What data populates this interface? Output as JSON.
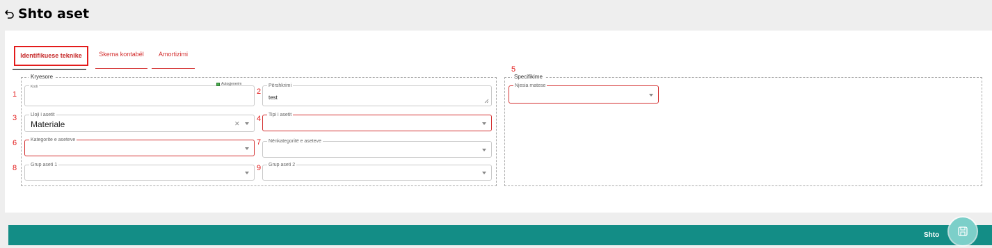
{
  "header": {
    "title": "Shto aset",
    "back_icon": "undo-arrow-icon"
  },
  "tabs": [
    {
      "label": "Identifikuese teknike",
      "active": true
    },
    {
      "label": "Skema kontabël",
      "active": false
    },
    {
      "label": "Amortizimi",
      "active": false
    }
  ],
  "kryesore": {
    "legend": "Kryesore",
    "kodi": {
      "label": "Kodi",
      "value": ""
    },
    "autogjenerim": {
      "label": "Autogjenerim",
      "checked": true
    },
    "pershkrimi": {
      "label": "Përshkrimi",
      "value": "test"
    },
    "lloji": {
      "label": "Lloji i asetit",
      "value": "Materiale"
    },
    "tipi": {
      "label": "Tipi i asetit",
      "value": ""
    },
    "kategorite": {
      "label": "Kategorite e aseteve",
      "value": ""
    },
    "nenkategorite": {
      "label": "Nënkategoritë e aseteve",
      "value": ""
    },
    "grup1": {
      "label": "Grup aseti 1",
      "value": ""
    },
    "grup2": {
      "label": "Grup aseti 2",
      "value": ""
    }
  },
  "specifikime": {
    "legend": "Specifikime",
    "njesia": {
      "label": "Njesia matese",
      "value": ""
    }
  },
  "annotations": [
    "1",
    "2",
    "3",
    "4",
    "5",
    "6",
    "7",
    "8",
    "9"
  ],
  "footer": {
    "submit_label": "Shto",
    "save_icon": "save-floppy-icon"
  },
  "colors": {
    "accent": "#138d86",
    "error": "#e31b1b",
    "tab_text": "#d32f2f",
    "save_button": "#7ccfc9"
  }
}
